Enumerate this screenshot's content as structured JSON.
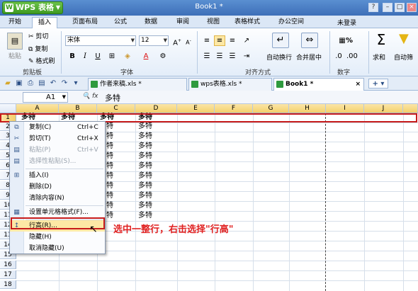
{
  "titlebar": {
    "app_button": "WPS 表格",
    "doc_title": "Book1 *",
    "login": "未登录"
  },
  "menu": [
    "开始",
    "插入",
    "页面布局",
    "公式",
    "数据",
    "审阅",
    "视图",
    "表格样式",
    "办公空间"
  ],
  "ribbon": {
    "clipboard": {
      "paste": "粘贴",
      "cut": "剪切",
      "copy": "复制",
      "format_painter": "格式刷",
      "group": "剪贴板"
    },
    "font": {
      "name": "宋体",
      "size": "12",
      "group": "字体"
    },
    "alignment": {
      "wrap": "自动换行",
      "merge": "合并居中",
      "group": "对齐方式"
    },
    "number": {
      "percent": "%",
      "group": "数字"
    },
    "sum": "求和",
    "filter": "自动筛"
  },
  "tabs": [
    {
      "label": "作者来稿.xls *",
      "active": false
    },
    {
      "label": "wps表格.xls *",
      "active": false
    },
    {
      "label": "Book1 *",
      "active": true
    }
  ],
  "formula_bar": {
    "cell": "A1",
    "fx": "fx",
    "value": "多特"
  },
  "grid": {
    "columns": [
      "A",
      "B",
      "C",
      "D",
      "E",
      "F",
      "G",
      "H",
      "I",
      "J"
    ],
    "rows": [
      "1",
      "2",
      "3",
      "4",
      "5",
      "6",
      "7",
      "8",
      "9",
      "10",
      "11",
      "12",
      "13",
      "14",
      "15",
      "16",
      "17",
      "18"
    ],
    "row1": [
      "多特",
      "多特",
      "多特",
      "多特"
    ],
    "colC": [
      "特",
      "特",
      "特",
      "特",
      "特",
      "特",
      "特",
      "特",
      "特",
      "特"
    ],
    "colD": [
      "多特",
      "多特",
      "多特",
      "多特",
      "多特",
      "多特",
      "多特",
      "多特",
      "多特",
      "多特"
    ]
  },
  "context_menu": {
    "items": [
      {
        "label": "复制(C)",
        "shortcut": "Ctrl+C",
        "icon": "copy-icon",
        "disabled": false
      },
      {
        "label": "剪切(T)",
        "shortcut": "Ctrl+X",
        "icon": "scissors-icon",
        "disabled": false
      },
      {
        "label": "粘贴(P)",
        "shortcut": "Ctrl+V",
        "icon": "paste-icon",
        "disabled": true
      },
      {
        "label": "选择性粘贴(S)...",
        "shortcut": "",
        "icon": "paste-special-icon",
        "disabled": true
      },
      {
        "label": "插入(I)",
        "shortcut": "",
        "icon": "insert-icon",
        "disabled": false
      },
      {
        "label": "删除(D)",
        "shortcut": "",
        "icon": "",
        "disabled": false
      },
      {
        "label": "清除内容(N)",
        "shortcut": "",
        "icon": "",
        "disabled": false
      },
      {
        "label": "设置单元格格式(F)...",
        "shortcut": "",
        "icon": "format-cells-icon",
        "disabled": false
      },
      {
        "label": "行高(R)...",
        "shortcut": "",
        "icon": "row-height-icon",
        "disabled": false
      },
      {
        "label": "隐藏(H)",
        "shortcut": "",
        "icon": "",
        "disabled": false
      },
      {
        "label": "取消隐藏(U)",
        "shortcut": "",
        "icon": "",
        "disabled": false
      }
    ]
  },
  "annotation": "选中一整行，右击选择\"行高\"",
  "colors": {
    "accent": "#c71b1b",
    "selection": "#fde8a5",
    "title_bg": "#3d6fb8"
  }
}
